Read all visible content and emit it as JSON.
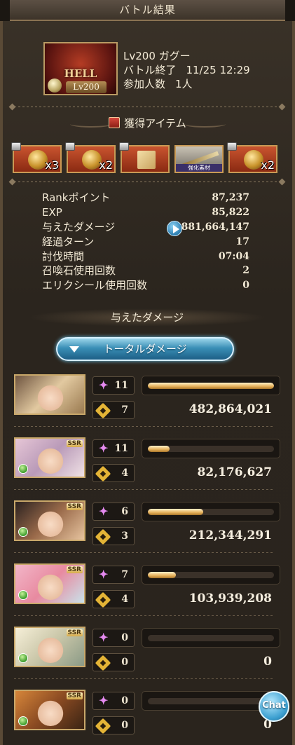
{
  "title": "バトル結果",
  "quest": {
    "thumb_text": "HELL",
    "thumb_level": "Lv200",
    "name": "Lv200 ガグー",
    "end_label": "バトル終了",
    "end_time": "11/25 12:29",
    "players_label": "参加人数",
    "players_value": "1人"
  },
  "loot": {
    "heading": "獲得アイテム",
    "items": [
      {
        "name": "gold-medal",
        "count": "x3"
      },
      {
        "name": "gear-orb",
        "count": "x2"
      },
      {
        "name": "scroll",
        "count": ""
      },
      {
        "name": "spear-material",
        "count": "",
        "tag": "強化素材"
      },
      {
        "name": "gold-medal",
        "count": "x2"
      }
    ]
  },
  "stats": [
    {
      "label": "Rankポイント",
      "value": "87,237"
    },
    {
      "label": "EXP",
      "value": "85,822"
    },
    {
      "label": "与えたダメージ",
      "value": "881,664,147"
    },
    {
      "label": "経過ターン",
      "value": "17"
    },
    {
      "label": "討伐時間",
      "value": "07:04"
    },
    {
      "label": "召喚石使用回数",
      "value": "2"
    },
    {
      "label": "エリクシール使用回数",
      "value": "0"
    }
  ],
  "damage_heading": "与えたダメージ",
  "total_button": "トータルダメージ",
  "characters": [
    {
      "portrait": "main-character-pair",
      "ssr": "",
      "attacks": "11",
      "skills": "7",
      "damage": "482,864,021",
      "share": 1.0
    },
    {
      "portrait": "character-2",
      "ssr": "SSR",
      "attacks": "11",
      "skills": "4",
      "damage": "82,176,627",
      "share": 0.17
    },
    {
      "portrait": "character-3",
      "ssr": "SSR",
      "attacks": "6",
      "skills": "3",
      "damage": "212,344,291",
      "share": 0.44
    },
    {
      "portrait": "character-4",
      "ssr": "SSR",
      "attacks": "7",
      "skills": "4",
      "damage": "103,939,208",
      "share": 0.22
    },
    {
      "portrait": "character-5",
      "ssr": "SSR",
      "attacks": "0",
      "skills": "0",
      "damage": "0",
      "share": 0
    },
    {
      "portrait": "character-6",
      "ssr": "SSR",
      "attacks": "0",
      "skills": "0",
      "damage": "0",
      "share": 0
    }
  ],
  "chat_label": "Chat"
}
